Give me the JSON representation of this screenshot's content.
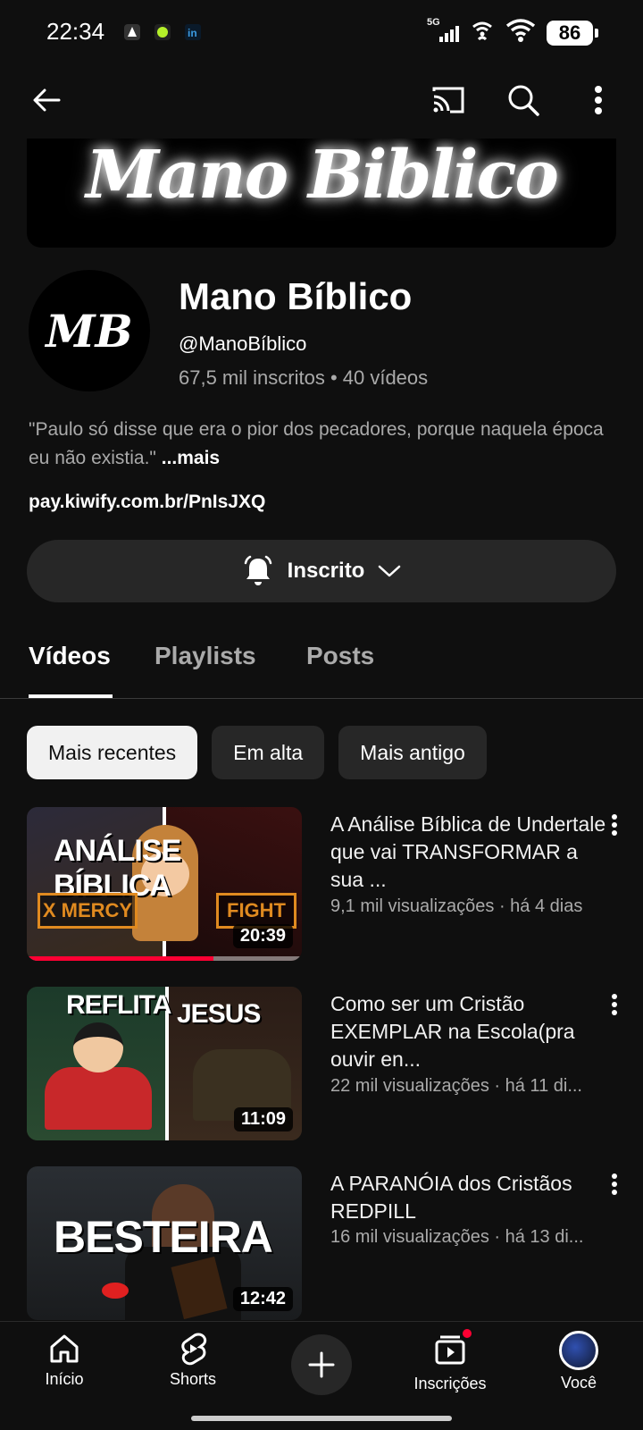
{
  "status_bar": {
    "time": "22:34",
    "network": "5G",
    "battery": "86"
  },
  "banner": {
    "text": "Mano Biblico"
  },
  "channel": {
    "avatar_text": "MB",
    "name": "Mano Bíblico",
    "handle": "@ManoBíblico",
    "meta": "67,5 mil inscritos • 40 vídeos",
    "description": "\"Paulo só disse que era o pior dos pecadores, porque naquela época eu não existia.\"",
    "description_more": "...mais",
    "link": "pay.kiwify.com.br/PnIsJXQ"
  },
  "subscribe": {
    "label": "Inscrito"
  },
  "tabs": [
    {
      "label": "Vídeos"
    },
    {
      "label": "Playlists"
    },
    {
      "label": "Posts"
    }
  ],
  "chips": [
    {
      "label": "Mais recentes"
    },
    {
      "label": "Em alta"
    },
    {
      "label": "Mais antigo"
    }
  ],
  "videos": [
    {
      "title": "A Análise Bíblica de Undertale que vai TRANSFORMAR a sua ...",
      "meta": "9,1 mil visualizações · há 4 dias",
      "duration": "20:39",
      "thumb_text_left": "ANÁLISE BÍBLICA",
      "thumb_mercy": "X MERCY",
      "thumb_fight": "FIGHT",
      "progress": 0.68
    },
    {
      "title": "Como ser um Cristão EXEMPLAR na Escola(pra ouvir en...",
      "meta": "22 mil visualizações · há 11 di...",
      "duration": "11:09",
      "thumb_text_left": "REFLITA",
      "thumb_text_right": "JESUS"
    },
    {
      "title": "A PARANÓIA dos Cristãos REDPILL",
      "meta": "16 mil visualizações · há 13 di...",
      "duration": "12:42",
      "thumb_text_left": "BESTEIRA"
    }
  ],
  "bottom_nav": [
    {
      "label": "Início",
      "icon": "home-icon"
    },
    {
      "label": "Shorts",
      "icon": "shorts-icon"
    },
    {
      "label": "",
      "icon": "create-icon"
    },
    {
      "label": "Inscrições",
      "icon": "subscriptions-icon"
    },
    {
      "label": "Você",
      "icon": "you-avatar"
    }
  ],
  "colors": {
    "background": "#0f0f0f",
    "chip_bg": "#272727",
    "accent_red": "#ff0033",
    "secondary_text": "#aaaaaa"
  }
}
